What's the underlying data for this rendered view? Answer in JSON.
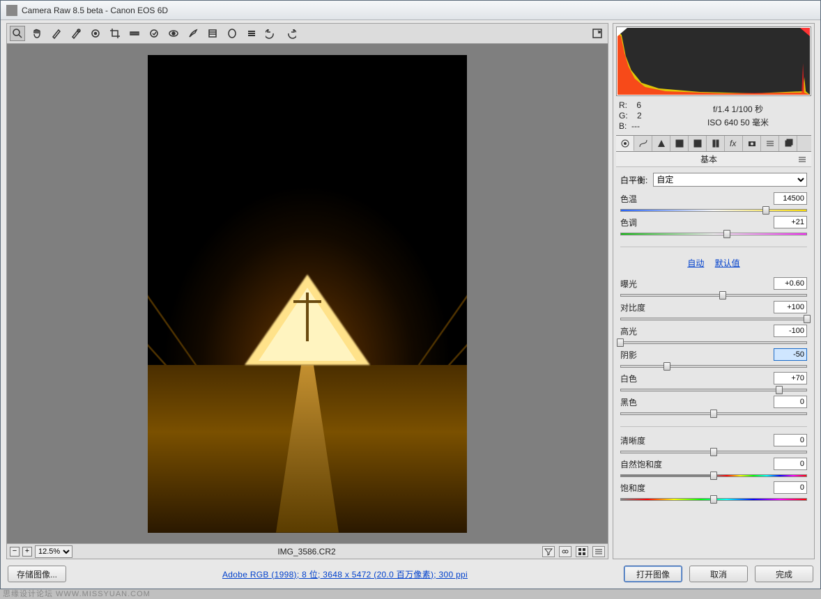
{
  "window": {
    "title": "Camera Raw 8.5 beta -  Canon EOS 6D"
  },
  "preview": {
    "filename": "IMG_3586.CR2",
    "zoom": "12.5%"
  },
  "exif": {
    "r_label": "R:",
    "r": "6",
    "g_label": "G:",
    "g": "2",
    "b_label": "B:",
    "b": "---",
    "aperture_shutter": "f/1.4  1/100 秒",
    "iso_fl": "ISO 640   50 毫米"
  },
  "panel": {
    "title": "基本",
    "wb_label": "白平衡:",
    "wb_value": "自定",
    "links": {
      "auto": "自动",
      "default": "默认值"
    }
  },
  "sliders": {
    "temp": {
      "label": "色温",
      "value": "14500",
      "pos": 78
    },
    "tint": {
      "label": "色调",
      "value": "+21",
      "pos": 57
    },
    "exposure": {
      "label": "曝光",
      "value": "+0.60",
      "pos": 55
    },
    "contrast": {
      "label": "对比度",
      "value": "+100",
      "pos": 100
    },
    "highlights": {
      "label": "高光",
      "value": "-100",
      "pos": 0
    },
    "shadows": {
      "label": "阴影",
      "value": "-50",
      "pos": 25,
      "selected": true
    },
    "whites": {
      "label": "白色",
      "value": "+70",
      "pos": 85
    },
    "blacks": {
      "label": "黑色",
      "value": "0",
      "pos": 50
    },
    "clarity": {
      "label": "清晰度",
      "value": "0",
      "pos": 50
    },
    "vibrance": {
      "label": "自然饱和度",
      "value": "0",
      "pos": 50
    },
    "saturation": {
      "label": "饱和度",
      "value": "0",
      "pos": 50
    }
  },
  "footer": {
    "save": "存储图像...",
    "info": "Adobe RGB (1998); 8 位; 3648 x 5472 (20.0 百万像素); 300 ppi",
    "open": "打开图像",
    "cancel": "取消",
    "done": "完成"
  },
  "watermark": "思缘设计论坛  WWW.MISSYUAN.COM"
}
